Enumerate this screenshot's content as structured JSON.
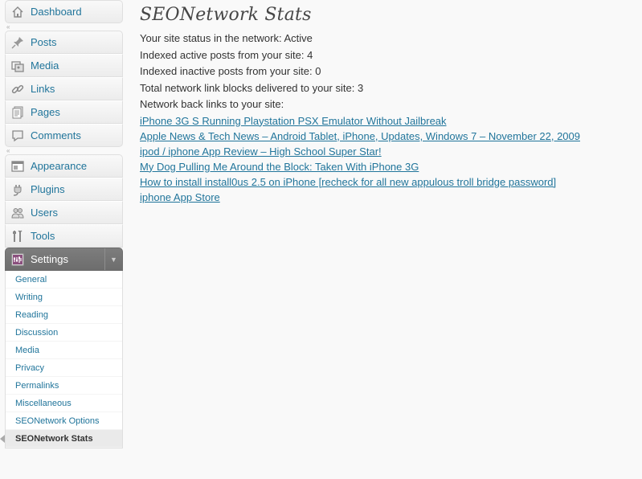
{
  "sidebar": {
    "dashboard": {
      "label": "Dashboard",
      "icon": "home-icon"
    },
    "group1": [
      {
        "label": "Posts",
        "icon": "pushpin-icon"
      },
      {
        "label": "Media",
        "icon": "media-icon"
      },
      {
        "label": "Links",
        "icon": "link-icon"
      },
      {
        "label": "Pages",
        "icon": "pages-icon"
      },
      {
        "label": "Comments",
        "icon": "comment-icon"
      }
    ],
    "group2": [
      {
        "label": "Appearance",
        "icon": "appearance-icon"
      },
      {
        "label": "Plugins",
        "icon": "plugin-icon"
      },
      {
        "label": "Users",
        "icon": "users-icon"
      },
      {
        "label": "Tools",
        "icon": "tools-icon"
      }
    ],
    "settings": {
      "label": "Settings",
      "icon": "settings-icon",
      "submenu": [
        "General",
        "Writing",
        "Reading",
        "Discussion",
        "Media",
        "Privacy",
        "Permalinks",
        "Miscellaneous",
        "SEONetwork Options",
        "SEONetwork Stats"
      ],
      "current": "SEONetwork Stats"
    }
  },
  "main": {
    "title": "SEONetwork Stats",
    "stats": [
      "Your site status in the network: Active",
      "Indexed active posts from your site: 4",
      "Indexed inactive posts from your site: 0",
      "Total network link blocks delivered to your site: 3",
      "Network back links to your site:"
    ],
    "backlinks": [
      "iPhone 3G S Running Playstation PSX Emulator Without Jailbreak",
      "Apple News & Tech News – Android Tablet, iPhone, Updates, Windows 7 – November 22, 2009",
      "ipod / iphone App Review – High School Super Star!",
      "My Dog Pulling Me Around the Block: Taken With iPhone 3G",
      "How to install install0us 2.5 on iPhone [recheck for all new appulous troll bridge password]",
      "iphone App Store"
    ]
  },
  "colors": {
    "link": "#21759b",
    "active_menu": "#6d6d6d",
    "background": "#f9f9f9"
  }
}
